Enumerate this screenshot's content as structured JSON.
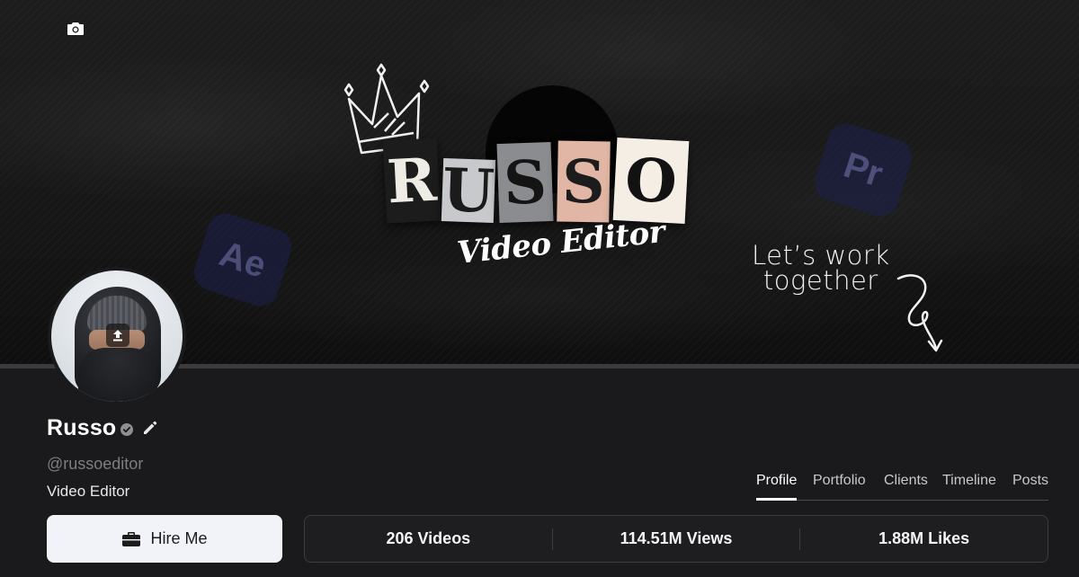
{
  "banner": {
    "letters": [
      "R",
      "U",
      "S",
      "S",
      "O"
    ],
    "subtitle": "Video Editor",
    "logo_ae": "Ae",
    "logo_pr": "Pr",
    "cta_line1": "Let’s work",
    "cta_line2": "together"
  },
  "profile": {
    "name": "Russo",
    "handle": "@russoeditor",
    "role": "Video Editor"
  },
  "tabs": [
    {
      "label": "Profile",
      "active": true
    },
    {
      "label": "Portfolio",
      "active": false
    },
    {
      "label": "Clients",
      "active": false
    },
    {
      "label": "Timeline",
      "active": false
    },
    {
      "label": "Posts",
      "active": false
    }
  ],
  "actions": {
    "hire_label": "Hire Me"
  },
  "stats": {
    "videos": "206 Videos",
    "views": "114.51M Views",
    "likes": "1.88M Likes"
  },
  "colors": {
    "background": "#1a191b",
    "button_bg": "#f2f3f8",
    "accent_text": "#ffffff",
    "muted_text": "#7e7e82"
  },
  "icons": {
    "camera": "camera-icon",
    "upload": "upload-icon",
    "verified": "verified-badge-icon",
    "edit": "pencil-icon",
    "briefcase": "briefcase-icon"
  }
}
